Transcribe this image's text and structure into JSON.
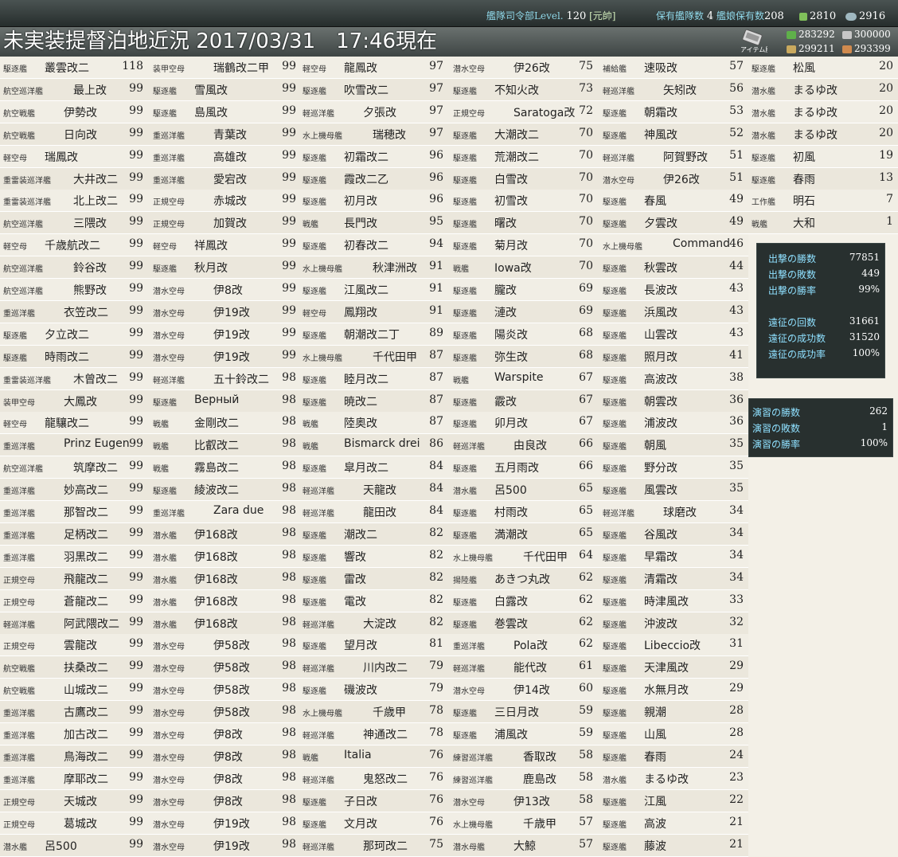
{
  "header": {
    "fleet_hq_label": "艦隊司令部Level.",
    "fleet_hq_level": "120",
    "rank": "[元帥]",
    "ships_owned_label": "保有艦隊数",
    "ships_owned": "4",
    "shipgirls_label": "艦娘保有数",
    "shipgirls": "208",
    "buckets": "2810",
    "screws": "2916",
    "title": "未実装提督泊地近況 2017/03/31　17:46現在",
    "item_button_label": "アイテム屋",
    "fuel": "283292",
    "steel": "300000",
    "ammo": "299211",
    "bauxite": "293399"
  },
  "columns": [
    [
      [
        "駆逐艦",
        "叢雲改二",
        "118"
      ],
      [
        "航空巡洋艦",
        "最上改",
        "99"
      ],
      [
        "航空戦艦",
        "伊勢改",
        "99"
      ],
      [
        "航空戦艦",
        "日向改",
        "99"
      ],
      [
        "軽空母",
        "瑞鳳改",
        "99"
      ],
      [
        "重雷装巡洋艦",
        "大井改二",
        "99"
      ],
      [
        "重雷装巡洋艦",
        "北上改二",
        "99"
      ],
      [
        "航空巡洋艦",
        "三隈改",
        "99"
      ],
      [
        "軽空母",
        "千歳航改二",
        "99"
      ],
      [
        "航空巡洋艦",
        "鈴谷改",
        "99"
      ],
      [
        "航空巡洋艦",
        "熊野改",
        "99"
      ],
      [
        "重巡洋艦",
        "衣笠改二",
        "99"
      ],
      [
        "駆逐艦",
        "夕立改二",
        "99"
      ],
      [
        "駆逐艦",
        "時雨改二",
        "99"
      ],
      [
        "重雷装巡洋艦",
        "木曾改二",
        "99"
      ],
      [
        "装甲空母",
        "大鳳改",
        "99"
      ],
      [
        "軽空母",
        "龍驤改二",
        "99"
      ],
      [
        "重巡洋艦",
        "Prinz Eugen",
        "99"
      ],
      [
        "航空巡洋艦",
        "筑摩改二",
        "99"
      ],
      [
        "重巡洋艦",
        "妙高改二",
        "99"
      ],
      [
        "重巡洋艦",
        "那智改二",
        "99"
      ],
      [
        "重巡洋艦",
        "足柄改二",
        "99"
      ],
      [
        "重巡洋艦",
        "羽黒改二",
        "99"
      ],
      [
        "正規空母",
        "飛龍改二",
        "99"
      ],
      [
        "正規空母",
        "蒼龍改二",
        "99"
      ],
      [
        "軽巡洋艦",
        "阿武隈改二",
        "99"
      ],
      [
        "正規空母",
        "雲龍改",
        "99"
      ],
      [
        "航空戦艦",
        "扶桑改二",
        "99"
      ],
      [
        "航空戦艦",
        "山城改二",
        "99"
      ],
      [
        "重巡洋艦",
        "古鷹改二",
        "99"
      ],
      [
        "重巡洋艦",
        "加古改二",
        "99"
      ],
      [
        "重巡洋艦",
        "鳥海改二",
        "99"
      ],
      [
        "重巡洋艦",
        "摩耶改二",
        "99"
      ],
      [
        "正規空母",
        "天城改",
        "99"
      ],
      [
        "正規空母",
        "葛城改",
        "99"
      ],
      [
        "潜水艦",
        "呂500",
        "99"
      ]
    ],
    [
      [
        "装甲空母",
        "瑞鶴改二甲",
        "99"
      ],
      [
        "駆逐艦",
        "雪風改",
        "99"
      ],
      [
        "駆逐艦",
        "島風改",
        "99"
      ],
      [
        "重巡洋艦",
        "青葉改",
        "99"
      ],
      [
        "重巡洋艦",
        "高雄改",
        "99"
      ],
      [
        "重巡洋艦",
        "愛宕改",
        "99"
      ],
      [
        "正規空母",
        "赤城改",
        "99"
      ],
      [
        "正規空母",
        "加賀改",
        "99"
      ],
      [
        "軽空母",
        "祥鳳改",
        "99"
      ],
      [
        "駆逐艦",
        "秋月改",
        "99"
      ],
      [
        "潜水空母",
        "伊8改",
        "99"
      ],
      [
        "潜水空母",
        "伊19改",
        "99"
      ],
      [
        "潜水空母",
        "伊19改",
        "99"
      ],
      [
        "潜水空母",
        "伊19改",
        "99"
      ],
      [
        "軽巡洋艦",
        "五十鈴改二",
        "98"
      ],
      [
        "駆逐艦",
        "Верный",
        "98"
      ],
      [
        "戦艦",
        "金剛改二",
        "98"
      ],
      [
        "戦艦",
        "比叡改二",
        "98"
      ],
      [
        "戦艦",
        "霧島改二",
        "98"
      ],
      [
        "駆逐艦",
        "綾波改二",
        "98"
      ],
      [
        "重巡洋艦",
        "Zara due",
        "98"
      ],
      [
        "潜水艦",
        "伊168改",
        "98"
      ],
      [
        "潜水艦",
        "伊168改",
        "98"
      ],
      [
        "潜水艦",
        "伊168改",
        "98"
      ],
      [
        "潜水艦",
        "伊168改",
        "98"
      ],
      [
        "潜水艦",
        "伊168改",
        "98"
      ],
      [
        "潜水空母",
        "伊58改",
        "98"
      ],
      [
        "潜水空母",
        "伊58改",
        "98"
      ],
      [
        "潜水空母",
        "伊58改",
        "98"
      ],
      [
        "潜水空母",
        "伊58改",
        "98"
      ],
      [
        "潜水空母",
        "伊8改",
        "98"
      ],
      [
        "潜水空母",
        "伊8改",
        "98"
      ],
      [
        "潜水空母",
        "伊8改",
        "98"
      ],
      [
        "潜水空母",
        "伊8改",
        "98"
      ],
      [
        "潜水空母",
        "伊19改",
        "98"
      ],
      [
        "潜水空母",
        "伊19改",
        "98"
      ]
    ],
    [
      [
        "軽空母",
        "龍鳳改",
        "97"
      ],
      [
        "駆逐艦",
        "吹雪改二",
        "97"
      ],
      [
        "軽巡洋艦",
        "夕張改",
        "97"
      ],
      [
        "水上機母艦",
        "瑞穂改",
        "97"
      ],
      [
        "駆逐艦",
        "初霜改二",
        "96"
      ],
      [
        "駆逐艦",
        "霞改二乙",
        "96"
      ],
      [
        "駆逐艦",
        "初月改",
        "96"
      ],
      [
        "戦艦",
        "長門改",
        "95"
      ],
      [
        "駆逐艦",
        "初春改二",
        "94"
      ],
      [
        "水上機母艦",
        "秋津洲改",
        "91"
      ],
      [
        "駆逐艦",
        "江風改二",
        "91"
      ],
      [
        "軽空母",
        "鳳翔改",
        "91"
      ],
      [
        "駆逐艦",
        "朝潮改二丁",
        "89"
      ],
      [
        "水上機母艦",
        "千代田甲",
        "87"
      ],
      [
        "駆逐艦",
        "睦月改二",
        "87"
      ],
      [
        "駆逐艦",
        "暁改二",
        "87"
      ],
      [
        "戦艦",
        "陸奥改",
        "87"
      ],
      [
        "戦艦",
        "Bismarck drei",
        "86"
      ],
      [
        "駆逐艦",
        "皐月改二",
        "84"
      ],
      [
        "軽巡洋艦",
        "天龍改",
        "84"
      ],
      [
        "軽巡洋艦",
        "龍田改",
        "84"
      ],
      [
        "駆逐艦",
        "潮改二",
        "82"
      ],
      [
        "駆逐艦",
        "響改",
        "82"
      ],
      [
        "駆逐艦",
        "雷改",
        "82"
      ],
      [
        "駆逐艦",
        "電改",
        "82"
      ],
      [
        "軽巡洋艦",
        "大淀改",
        "82"
      ],
      [
        "駆逐艦",
        "望月改",
        "81"
      ],
      [
        "軽巡洋艦",
        "川内改二",
        "79"
      ],
      [
        "駆逐艦",
        "磯波改",
        "79"
      ],
      [
        "水上機母艦",
        "千歳甲",
        "78"
      ],
      [
        "軽巡洋艦",
        "神通改二",
        "78"
      ],
      [
        "戦艦",
        "Italia",
        "76"
      ],
      [
        "軽巡洋艦",
        "鬼怒改二",
        "76"
      ],
      [
        "駆逐艦",
        "子日改",
        "76"
      ],
      [
        "駆逐艦",
        "文月改",
        "76"
      ],
      [
        "軽巡洋艦",
        "那珂改二",
        "75"
      ]
    ],
    [
      [
        "潜水空母",
        "伊26改",
        "75"
      ],
      [
        "駆逐艦",
        "不知火改",
        "73"
      ],
      [
        "正規空母",
        "Saratoga改",
        "72"
      ],
      [
        "駆逐艦",
        "大潮改二",
        "70"
      ],
      [
        "駆逐艦",
        "荒潮改二",
        "70"
      ],
      [
        "駆逐艦",
        "白雪改",
        "70"
      ],
      [
        "駆逐艦",
        "初雪改",
        "70"
      ],
      [
        "駆逐艦",
        "曙改",
        "70"
      ],
      [
        "駆逐艦",
        "菊月改",
        "70"
      ],
      [
        "戦艦",
        "Iowa改",
        "70"
      ],
      [
        "駆逐艦",
        "朧改",
        "69"
      ],
      [
        "駆逐艦",
        "漣改",
        "69"
      ],
      [
        "駆逐艦",
        "陽炎改",
        "68"
      ],
      [
        "駆逐艦",
        "弥生改",
        "68"
      ],
      [
        "戦艦",
        "Warspite",
        "67"
      ],
      [
        "駆逐艦",
        "霰改",
        "67"
      ],
      [
        "駆逐艦",
        "卯月改",
        "67"
      ],
      [
        "軽巡洋艦",
        "由良改",
        "66"
      ],
      [
        "駆逐艦",
        "五月雨改",
        "66"
      ],
      [
        "潜水艦",
        "呂500",
        "65"
      ],
      [
        "駆逐艦",
        "村雨改",
        "65"
      ],
      [
        "駆逐艦",
        "満潮改",
        "65"
      ],
      [
        "水上機母艦",
        "千代田甲",
        "64"
      ],
      [
        "揚陸艦",
        "あきつ丸改",
        "62"
      ],
      [
        "駆逐艦",
        "白露改",
        "62"
      ],
      [
        "駆逐艦",
        "巻雲改",
        "62"
      ],
      [
        "重巡洋艦",
        "Pola改",
        "62"
      ],
      [
        "軽巡洋艦",
        "能代改",
        "61"
      ],
      [
        "潜水空母",
        "伊14改",
        "60"
      ],
      [
        "駆逐艦",
        "三日月改",
        "59"
      ],
      [
        "駆逐艦",
        "浦風改",
        "59"
      ],
      [
        "練習巡洋艦",
        "香取改",
        "58"
      ],
      [
        "練習巡洋艦",
        "鹿島改",
        "58"
      ],
      [
        "潜水空母",
        "伊13改",
        "58"
      ],
      [
        "水上機母艦",
        "千歳甲",
        "57"
      ],
      [
        "潜水母艦",
        "大鯨",
        "57"
      ]
    ],
    [
      [
        "補給艦",
        "速吸改",
        "57"
      ],
      [
        "軽巡洋艦",
        "矢矧改",
        "56"
      ],
      [
        "駆逐艦",
        "朝霜改",
        "53"
      ],
      [
        "駆逐艦",
        "神風改",
        "52"
      ],
      [
        "軽巡洋艦",
        "阿賀野改",
        "51"
      ],
      [
        "潜水空母",
        "伊26改",
        "51"
      ],
      [
        "駆逐艦",
        "春風",
        "49"
      ],
      [
        "駆逐艦",
        "夕雲改",
        "49"
      ],
      [
        "水上機母艦",
        "Command",
        "46"
      ],
      [
        "駆逐艦",
        "秋雲改",
        "44"
      ],
      [
        "駆逐艦",
        "長波改",
        "43"
      ],
      [
        "駆逐艦",
        "浜風改",
        "43"
      ],
      [
        "駆逐艦",
        "山雲改",
        "43"
      ],
      [
        "駆逐艦",
        "照月改",
        "41"
      ],
      [
        "駆逐艦",
        "高波改",
        "38"
      ],
      [
        "駆逐艦",
        "朝雲改",
        "36"
      ],
      [
        "駆逐艦",
        "浦波改",
        "36"
      ],
      [
        "駆逐艦",
        "朝風",
        "35"
      ],
      [
        "駆逐艦",
        "野分改",
        "35"
      ],
      [
        "駆逐艦",
        "風雲改",
        "35"
      ],
      [
        "軽巡洋艦",
        "球磨改",
        "34"
      ],
      [
        "駆逐艦",
        "谷風改",
        "34"
      ],
      [
        "駆逐艦",
        "早霜改",
        "34"
      ],
      [
        "駆逐艦",
        "清霜改",
        "34"
      ],
      [
        "駆逐艦",
        "時津風改",
        "33"
      ],
      [
        "駆逐艦",
        "沖波改",
        "32"
      ],
      [
        "駆逐艦",
        "Libeccio改",
        "31"
      ],
      [
        "駆逐艦",
        "天津風改",
        "29"
      ],
      [
        "駆逐艦",
        "水無月改",
        "29"
      ],
      [
        "駆逐艦",
        "親潮",
        "28"
      ],
      [
        "駆逐艦",
        "山風",
        "28"
      ],
      [
        "駆逐艦",
        "春雨",
        "24"
      ],
      [
        "潜水艦",
        "まるゆ改",
        "23"
      ],
      [
        "駆逐艦",
        "江風",
        "22"
      ],
      [
        "駆逐艦",
        "高波",
        "21"
      ],
      [
        "駆逐艦",
        "藤波",
        "21"
      ]
    ],
    [
      [
        "駆逐艦",
        "松風",
        "20"
      ],
      [
        "潜水艦",
        "まるゆ改",
        "20"
      ],
      [
        "潜水艦",
        "まるゆ改",
        "20"
      ],
      [
        "潜水艦",
        "まるゆ改",
        "20"
      ],
      [
        "駆逐艦",
        "初風",
        "19"
      ],
      [
        "駆逐艦",
        "春雨",
        "13"
      ],
      [
        "工作艦",
        "明石",
        "7"
      ],
      [
        "戦艦",
        "大和",
        "1"
      ]
    ]
  ],
  "sortie": {
    "wins_label": "出撃の勝数",
    "wins": "77851",
    "losses_label": "出撃の敗数",
    "losses": "449",
    "rate_label": "出撃の勝率",
    "rate": "99%",
    "exp_count_label": "遠征の回数",
    "exp_count": "31661",
    "exp_success_label": "遠征の成功数",
    "exp_success": "31520",
    "exp_rate_label": "遠征の成功率",
    "exp_rate": "100%"
  },
  "exercise": {
    "wins_label": "演習の勝数",
    "wins": "262",
    "losses_label": "演習の敗数",
    "losses": "1",
    "rate_label": "演習の勝率",
    "rate": "100%"
  }
}
